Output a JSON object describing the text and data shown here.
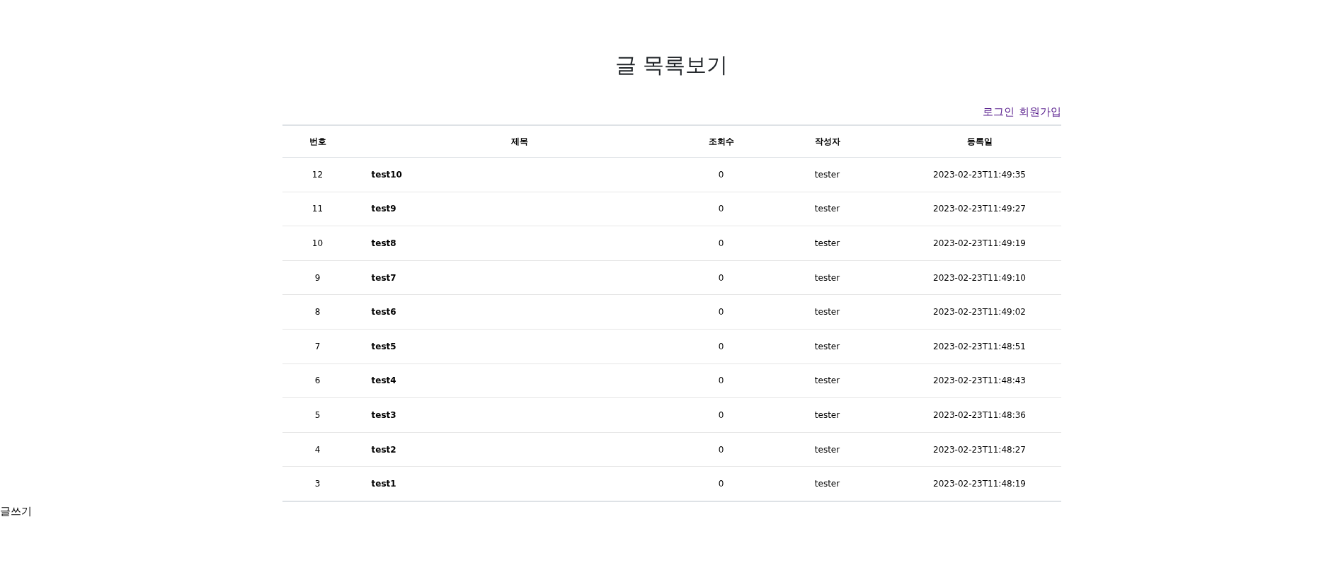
{
  "page_title": "글 목록보기",
  "auth_links": [
    "로그인",
    "회원가입"
  ],
  "table": {
    "columns": [
      "번호",
      "제목",
      "조회수",
      "작성자",
      "등록일"
    ],
    "rows": [
      {
        "number": "12",
        "title": "test10",
        "views": "0",
        "author": "tester",
        "date": "2023-02-23T11:49:35"
      },
      {
        "number": "11",
        "title": "test9",
        "views": "0",
        "author": "tester",
        "date": "2023-02-23T11:49:27"
      },
      {
        "number": "10",
        "title": "test8",
        "views": "0",
        "author": "tester",
        "date": "2023-02-23T11:49:19"
      },
      {
        "number": "9",
        "title": "test7",
        "views": "0",
        "author": "tester",
        "date": "2023-02-23T11:49:10"
      },
      {
        "number": "8",
        "title": "test6",
        "views": "0",
        "author": "tester",
        "date": "2023-02-23T11:49:02"
      },
      {
        "number": "7",
        "title": "test5",
        "views": "0",
        "author": "tester",
        "date": "2023-02-23T11:48:51"
      },
      {
        "number": "6",
        "title": "test4",
        "views": "0",
        "author": "tester",
        "date": "2023-02-23T11:48:43"
      },
      {
        "number": "5",
        "title": "test3",
        "views": "0",
        "author": "tester",
        "date": "2023-02-23T11:48:36"
      },
      {
        "number": "4",
        "title": "test2",
        "views": "0",
        "author": "tester",
        "date": "2023-02-23T11:48:27"
      },
      {
        "number": "3",
        "title": "test1",
        "views": "0",
        "author": "tester",
        "date": "2023-02-23T11:48:19"
      }
    ]
  },
  "write_link": "글쓰기"
}
